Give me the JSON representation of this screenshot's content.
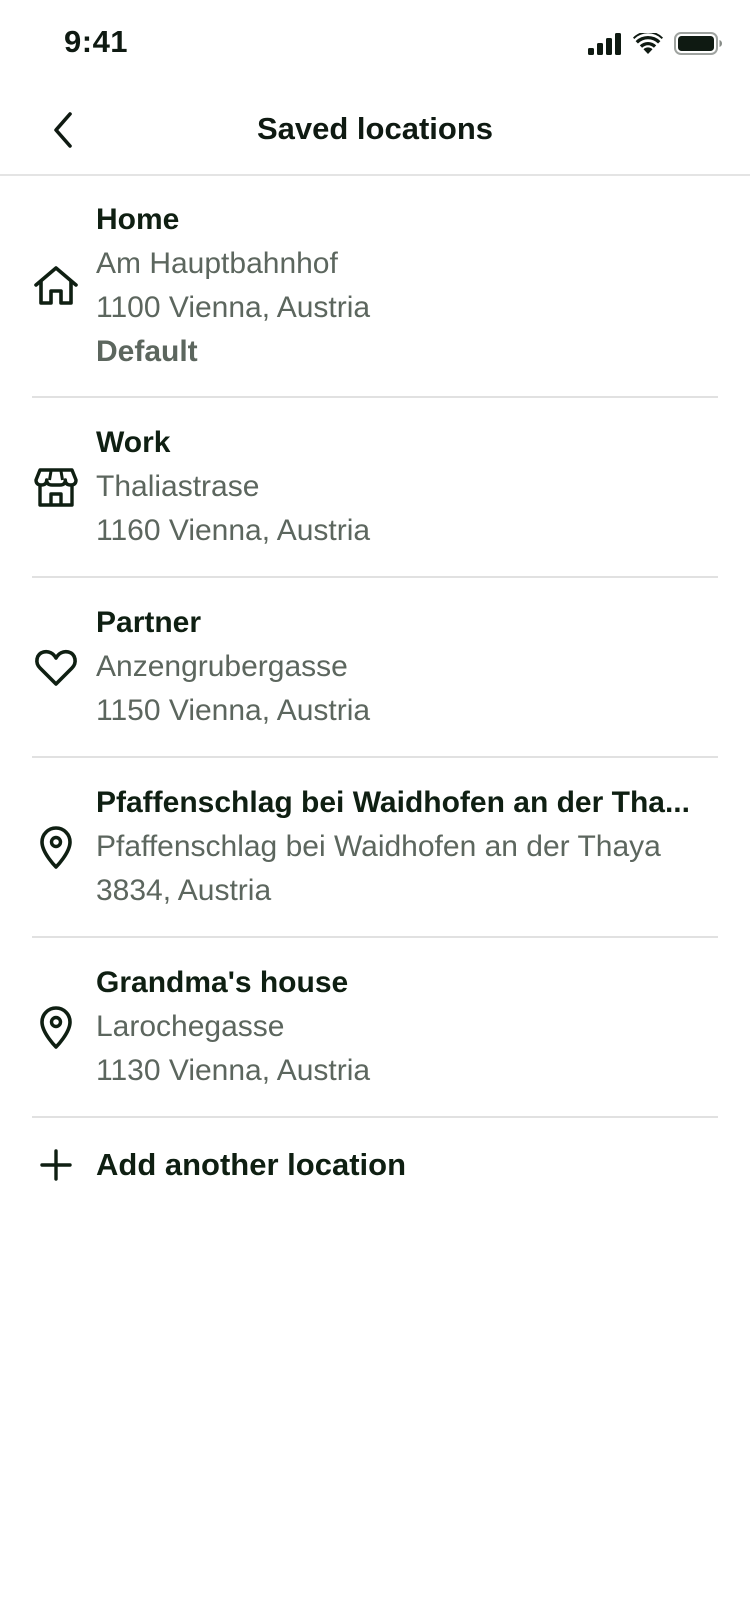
{
  "status_bar": {
    "time": "9:41",
    "icons": [
      "signal-icon",
      "wifi-icon",
      "battery-icon"
    ]
  },
  "header": {
    "title": "Saved locations",
    "back_icon": "chevron-left-icon"
  },
  "locations": [
    {
      "icon": "home-icon",
      "name": "Home",
      "street": "Am Hauptbahnhof",
      "city": "1100 Vienna, Austria",
      "tag": "Default"
    },
    {
      "icon": "store-icon",
      "name": "Work",
      "street": "Thaliastrase",
      "city": "1160 Vienna, Austria"
    },
    {
      "icon": "heart-icon",
      "name": "Partner",
      "street": "Anzengrubergasse",
      "city": "1150 Vienna, Austria"
    },
    {
      "icon": "map-pin-icon",
      "name": "Pfaffenschlag bei Waidhofen an der Tha...",
      "street": "Pfaffenschlag bei Waidhofen an der Thaya",
      "city": "3834, Austria"
    },
    {
      "icon": "map-pin-icon",
      "name": "Grandma's house",
      "street": "Larochegasse",
      "city": "1130 Vienna, Austria"
    }
  ],
  "add_action": {
    "icon": "plus-icon",
    "label": "Add another location"
  },
  "colors": {
    "text_primary": "#0f1f12",
    "text_secondary": "#5c665e",
    "divider": "#e1e1e1",
    "background": "#ffffff"
  }
}
